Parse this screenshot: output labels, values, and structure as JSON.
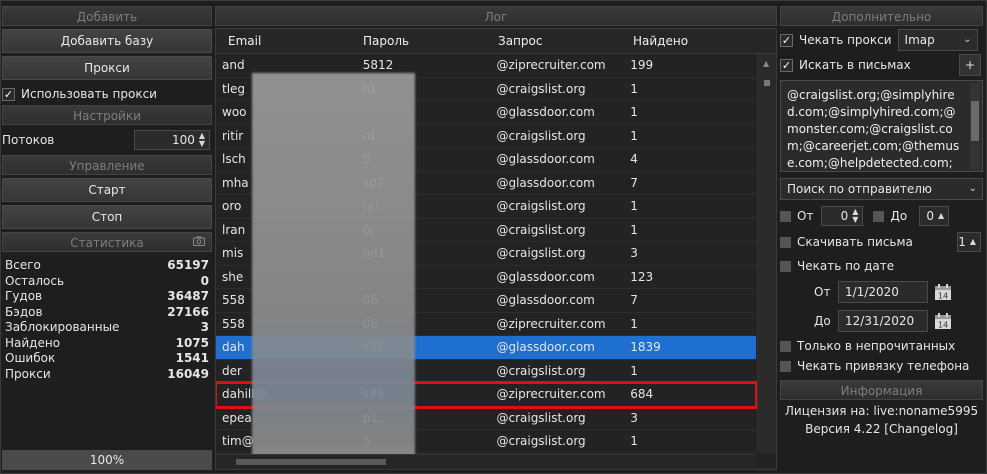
{
  "left": {
    "add_header": "Добавить",
    "add_base_button": "Добавить базу",
    "proxy_button": "Прокси",
    "use_proxy_label": "Использовать прокси",
    "settings_header": "Настройки",
    "threads_label": "Потоков",
    "threads_value": "100",
    "control_header": "Управление",
    "start_button": "Старт",
    "stop_button": "Стоп",
    "stats_header": "Статистика",
    "stats": [
      {
        "label": "Всего",
        "value": "65197"
      },
      {
        "label": "Осталось",
        "value": "0"
      },
      {
        "label": "Гудов",
        "value": "36487"
      },
      {
        "label": "Бэдов",
        "value": "27166"
      },
      {
        "label": "Заблокированные",
        "value": "3"
      },
      {
        "label": "Найдено",
        "value": "1075"
      },
      {
        "label": "Ошибок",
        "value": "1541"
      },
      {
        "label": "Прокси",
        "value": "16049"
      }
    ],
    "progress_label": "100%",
    "progress_fraction": 1.0
  },
  "log": {
    "header": "Лог",
    "columns": [
      "Email",
      "Пароль",
      "Запрос",
      "Найдено"
    ],
    "rows": [
      {
        "email": "and",
        "password": "5812",
        "query": "@ziprecruiter.com",
        "found": "199"
      },
      {
        "email": "tleg",
        "password": "rd",
        "query": "@craigslist.org",
        "found": "1"
      },
      {
        "email": "woo",
        "password": "",
        "query": "@glassdoor.com",
        "found": "1"
      },
      {
        "email": "ritir",
        "password": "rd",
        "query": "@craigslist.org",
        "found": "1"
      },
      {
        "email": "lsch",
        "password": "5",
        "query": "@glassdoor.com",
        "found": "4"
      },
      {
        "email": "mha",
        "password": "s07",
        "query": "@glassdoor.com",
        "found": "7"
      },
      {
        "email": "oro",
        "password": "ty!",
        "query": "@craigslist.org",
        "found": "1"
      },
      {
        "email": "lran",
        "password": "0j",
        "query": "@craigslist.org",
        "found": "1"
      },
      {
        "email": "mis",
        "password": "od1",
        "query": "@craigslist.org",
        "found": "3"
      },
      {
        "email": "she",
        "password": "",
        "query": "@glassdoor.com",
        "found": "123"
      },
      {
        "email": "558",
        "password": "06",
        "query": "@glassdoor.com",
        "found": "7"
      },
      {
        "email": "558",
        "password": "06",
        "query": "@ziprecruiter.com",
        "found": "1"
      },
      {
        "email": "dah",
        "password": "s99",
        "query": "@glassdoor.com",
        "found": "1839"
      },
      {
        "email": "der",
        "password": "",
        "query": "@craigslist.org",
        "found": "1"
      },
      {
        "email": "dahill@",
        "password": "s99",
        "query": "@ziprecruiter.com",
        "found": "684"
      },
      {
        "email": "epea",
        "password": "p1",
        "query": "@craigslist.org",
        "found": "3"
      },
      {
        "email": "tim@",
        "password": "5",
        "query": "@craigslist.org",
        "found": "1"
      }
    ],
    "selected_index": 12,
    "highlighted_index": 14
  },
  "right": {
    "header": "Дополнительно",
    "check_proxy_label": "Чекать прокси",
    "protocol_value": "Imap",
    "search_in_mail_label": "Искать в письмах",
    "add_symbol": "+",
    "search_text": "@craigslist.org;@simplyhired.com;@simplyhired.com;@monster.com;@craigslist.com;@careerjet.com;@themuse.com;@helpdetected.com;@glassdoor.com@linkup.com@",
    "search_mode": "Поиск по отправителю",
    "from_label": "От",
    "from_value": "0",
    "to_label": "До",
    "to_value": "0",
    "download_label": "Скачивать письма",
    "download_value": "1",
    "check_by_date_label": "Чекать по дате",
    "date_from_label": "От",
    "date_from": "1/1/2020",
    "date_to_label": "До",
    "date_to": "12/31/2020",
    "unread_only_label": "Только в непрочитанных",
    "phone_bind_label": "Чекать привязку телефона",
    "info_header": "Информация",
    "license_text": "Лицензия на: live:noname5995",
    "version_text": "Версия 4.22 [Changelog]"
  }
}
